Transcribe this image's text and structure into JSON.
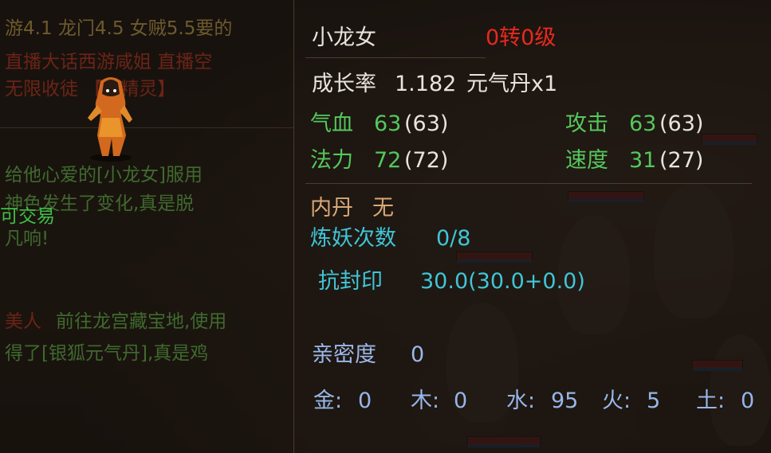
{
  "chat": {
    "lines": [
      "游4.1 龙门4.5 女贼5.5要的",
      "直播大话西游咸姐 直播空",
      "无限收徒 【刷精灵】",
      "给他心爱的[小龙女]服用",
      "神色发生了变化,真是脱",
      "可交易",
      "凡响!",
      "美人",
      "前往龙宫藏宝地,使用",
      "得了[银狐元气丹],真是鸡"
    ]
  },
  "pet": {
    "name": "小龙女",
    "rebirth_level": "0转0级",
    "growth_label": "成长率",
    "growth_value": "1.182",
    "yuanqi": "元气丹x1",
    "hp_label": "气血",
    "hp_value": "63",
    "hp_base": "(63)",
    "attack_label": "攻击",
    "attack_value": "63",
    "attack_base": "(63)",
    "mp_label": "法力",
    "mp_value": "72",
    "mp_base": "(72)",
    "speed_label": "速度",
    "speed_value": "31",
    "speed_base": "(27)",
    "neidan_label": "内丹",
    "neidan_value": "无",
    "lianyao_label": "炼妖次数",
    "lianyao_value": "0/8",
    "kangfeng_label": "抗封印",
    "kangfeng_value": "30.0(30.0+0.0)",
    "intimacy_label": "亲密度",
    "intimacy_value": "0",
    "elements": [
      {
        "label": "金:",
        "value": "0"
      },
      {
        "label": "木:",
        "value": "0"
      },
      {
        "label": "水:",
        "value": "95"
      },
      {
        "label": "火:",
        "value": "5"
      },
      {
        "label": "土:",
        "value": "0"
      }
    ]
  },
  "colors": {
    "rebirth": "#e8291e",
    "stat_value": "#54c85c",
    "neidan": "#d9a877",
    "cyan": "#3fc5d6",
    "blue": "#97b6e8"
  }
}
